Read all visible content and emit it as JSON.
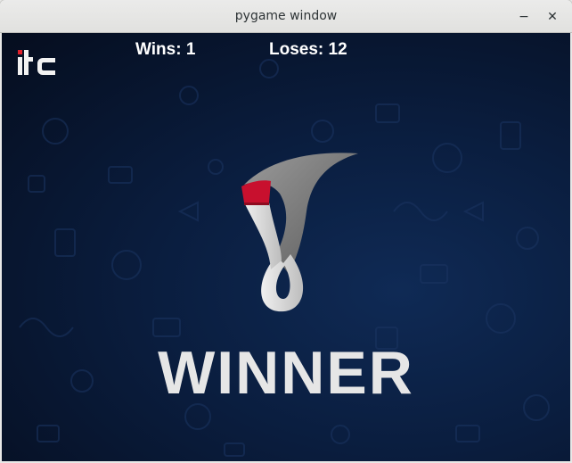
{
  "window": {
    "title": "pygame window",
    "minimize_glyph": "−",
    "close_glyph": "✕"
  },
  "hud": {
    "wins_text": "Wins: 1",
    "loses_text": "Loses: 12"
  },
  "logo": {
    "name": "itc-logo",
    "accent": "#e0202a"
  },
  "emblem": {
    "name": "world-cup-trophy-emblem"
  },
  "result": {
    "text": "WINNER"
  },
  "colors": {
    "background": "#0a1d3e",
    "hud_text": "#ffffff",
    "result_text": "#e6e6e6",
    "emblem_red": "#c8102e"
  }
}
